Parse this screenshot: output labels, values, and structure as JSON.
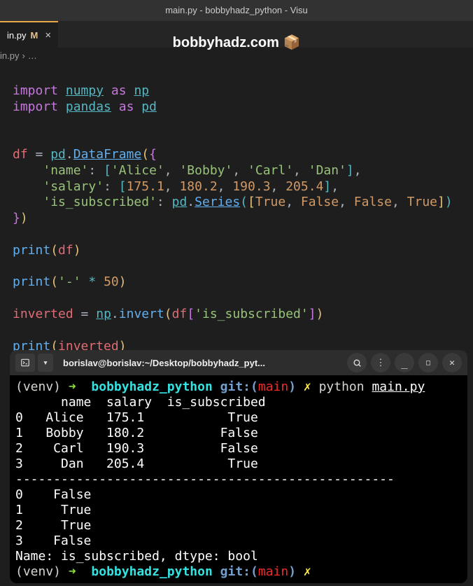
{
  "window": {
    "title": "main.py - bobbyhadz_python - Visu"
  },
  "tab": {
    "filename": "in.py",
    "modified_marker": "M",
    "close": "×"
  },
  "watermark": {
    "text": "bobbyhadz.com",
    "icon": "📦"
  },
  "breadcrumb": {
    "file": "in.py",
    "sep": "›",
    "more": "…"
  },
  "code": {
    "kw_import1": "import",
    "mod_numpy": "numpy",
    "kw_as1": "as",
    "alias_np": "np",
    "kw_import2": "import",
    "mod_pandas": "pandas",
    "kw_as2": "as",
    "alias_pd": "pd",
    "var_df": "df",
    "eq": "=",
    "pd": "pd",
    "dot": ".",
    "DataFrame": "DataFrame",
    "lp_y": "(",
    "rp_y": ")",
    "lb_p": "{",
    "rb_p": "}",
    "lb_b": "[",
    "rb_b": "]",
    "key_name": "'name'",
    "key_salary": "'salary'",
    "key_is_sub": "'is_subscribed'",
    "colon": ":",
    "comma": ",",
    "str_alice": "'Alice'",
    "str_bobby": "'Bobby'",
    "str_carl": "'Carl'",
    "str_dan": "'Dan'",
    "n1": "175.1",
    "n2": "180.2",
    "n3": "190.3",
    "n4": "205.4",
    "Series": "Series",
    "True": "True",
    "False": "False",
    "print": "print",
    "dash_str": "'-'",
    "star": "*",
    "fifty": "50",
    "inverted": "inverted",
    "np": "np",
    "invert": "invert",
    "is_sub_str": "'is_subscribed'"
  },
  "terminal": {
    "title": "borislav@borislav:~/Desktop/bobbyhadz_pyt...",
    "venv": "(venv)",
    "arrow": "➜",
    "dir": "bobbyhadz_python",
    "git": "git:(",
    "branch": "main",
    "git_close": ")",
    "dirty": "✗",
    "cmd_python": "python",
    "cmd_file": "main.py",
    "header": "      name  salary  is_subscribed",
    "rows": [
      "0   Alice   175.1           True",
      "1   Bobby   180.2          False",
      "2    Carl   190.3          False",
      "3     Dan   205.4           True"
    ],
    "divider": "--------------------------------------------------",
    "inv_rows": [
      "0    False",
      "1     True",
      "2     True",
      "3    False"
    ],
    "dtype_line": "Name: is_subscribed, dtype: bool"
  }
}
